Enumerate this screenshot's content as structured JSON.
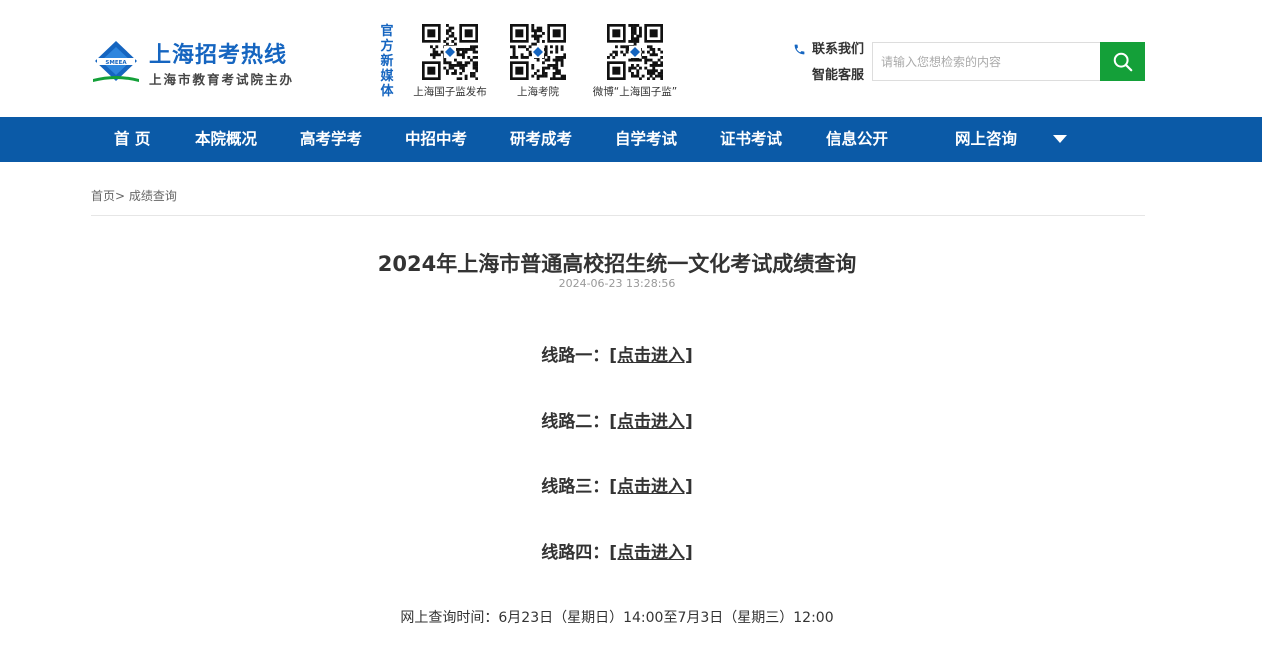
{
  "header": {
    "logo_title": "上海招考热线",
    "logo_subtitle": "上海市教育考试院主办",
    "logo_badge": "SMEEA",
    "media_label": [
      "官",
      "方",
      "新",
      "媒",
      "体"
    ],
    "qr_codes": [
      {
        "caption": "上海国子监发布"
      },
      {
        "caption": "上海考院"
      },
      {
        "caption": "微博“上海国子监”"
      }
    ],
    "contact_us": "联系我们",
    "smart_service": "智能客服",
    "search_placeholder": "请输入您想检索的内容",
    "search_icon": "search-icon",
    "accent_color": "#1565c0",
    "search_button_color": "#14a039"
  },
  "nav": {
    "bg_color": "#0b5aa7",
    "items": [
      {
        "label": "首 页"
      },
      {
        "label": "本院概况"
      },
      {
        "label": "高考学考"
      },
      {
        "label": "中招中考"
      },
      {
        "label": "研考成考"
      },
      {
        "label": "自学考试"
      },
      {
        "label": "证书考试"
      },
      {
        "label": "信息公开"
      },
      {
        "label": "网上咨询"
      }
    ]
  },
  "breadcrumb": {
    "home": "首页",
    "separator": ">",
    "current": "成绩查询"
  },
  "article": {
    "title": "2024年上海市普通高校招生统一文化考试成绩查询",
    "date": "2024-06-23 13:28:56",
    "routes": [
      {
        "label": "线路一：",
        "link": "[点击进入]"
      },
      {
        "label": "线路二：",
        "link": "[点击进入]"
      },
      {
        "label": "线路三：",
        "link": "[点击进入]"
      },
      {
        "label": "线路四：",
        "link": "[点击进入]"
      }
    ],
    "query_time": "网上查询时间：6月23日（星期日）14:00至7月3日（星期三）12:00"
  }
}
